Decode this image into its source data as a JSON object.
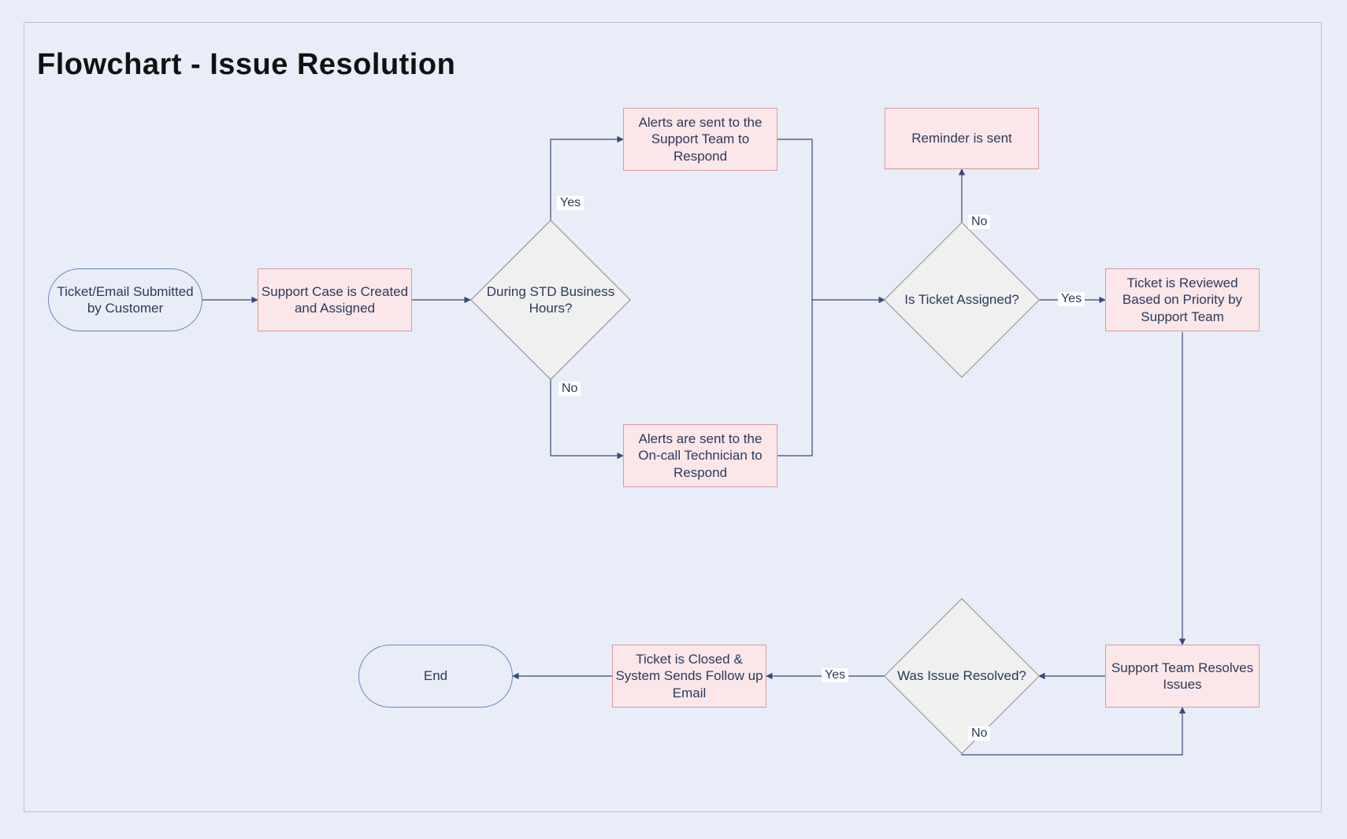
{
  "title": "Flowchart - Issue Resolution",
  "nodes": {
    "start": "Ticket/Email Submitted by Customer",
    "assign": "Support Case is Created and Assigned",
    "hours": "During STD Business Hours?",
    "alertTeam": "Alerts are sent to the Support Team to Respond",
    "alertOncall": "Alerts are sent to the On-call Technician to Respond",
    "reminder": "Reminder is sent",
    "isAssigned": "Is Ticket Assigned?",
    "reviewed": "Ticket is Reviewed Based  on Priority by Support Team",
    "resolves": "Support Team Resolves Issues",
    "wasResolved": "Was Issue Resolved?",
    "closed": "Ticket is Closed & System Sends Follow up Email",
    "end": "End"
  },
  "labels": {
    "yes": "Yes",
    "no": "No"
  },
  "colors": {
    "processFill": "#fbe6e9",
    "processStroke": "#d99aa0",
    "decisionFill": "#f0f0f0",
    "decisionStroke": "#8a8a8a",
    "terminalStroke": "#6b86c6",
    "arrow": "#394a7a",
    "canvasBg": "#e8edf7"
  }
}
